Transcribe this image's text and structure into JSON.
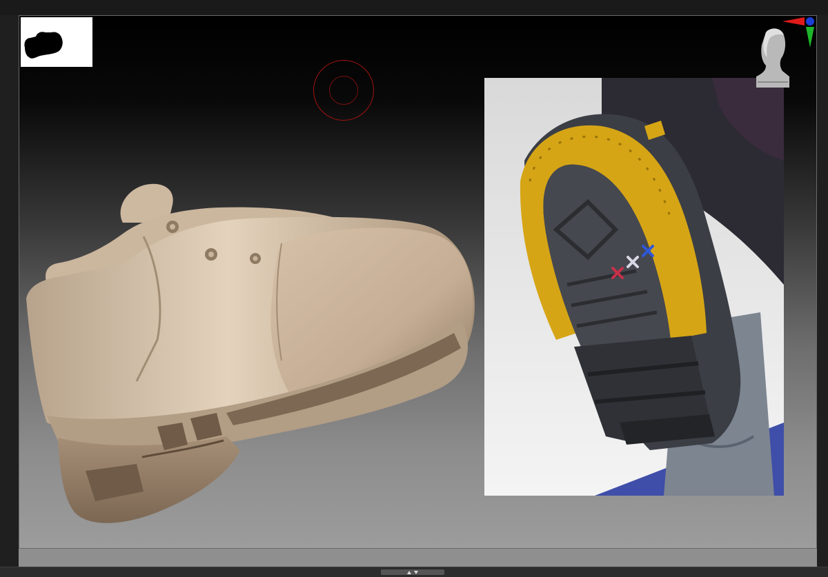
{
  "app": {
    "name": "",
    "colors": {
      "chrome": "#1f1f1f",
      "viewport_top": "#000000",
      "viewport_bottom": "#9c9c9c",
      "clay": "#d8c4ab",
      "brush_ring": "#a31212",
      "axis_x": "#e11a1a",
      "axis_y": "#1fb52a",
      "axis_z": "#1e3fd8"
    }
  },
  "viewport": {
    "navigator": {
      "icon": "boot-silhouette-icon"
    },
    "brush": {
      "icon": "brush-cursor-icon"
    },
    "model": {
      "icon": "clay-boot-model"
    },
    "reference": {
      "icon": "boot-sole-reference-image"
    },
    "camera": {
      "icon": "head-orientation-icon"
    },
    "gizmo": {
      "icon": "axis-gizmo-icon"
    }
  },
  "bottom_bar": {
    "handle_icon": "expand-collapse-icon"
  }
}
